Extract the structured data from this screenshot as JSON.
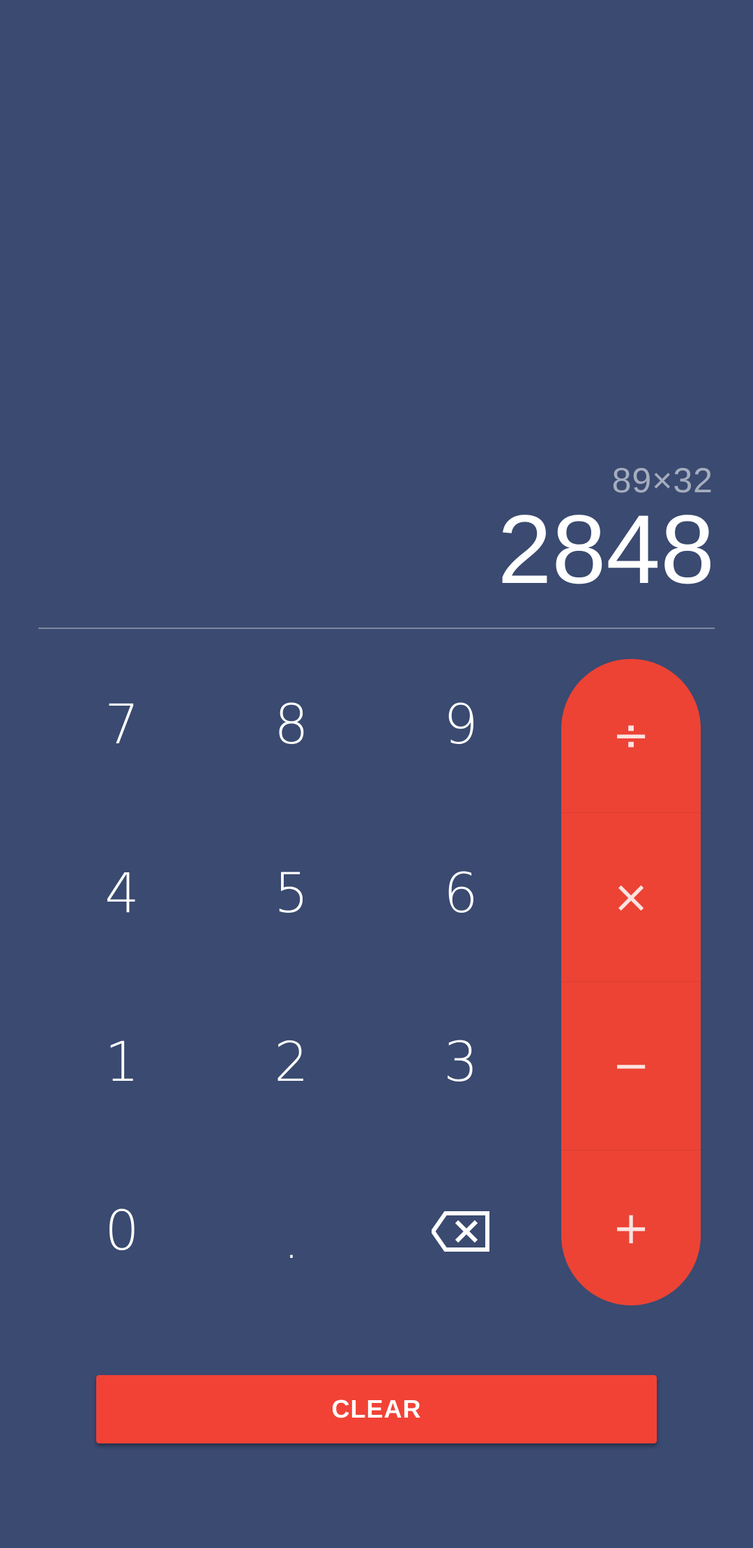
{
  "display": {
    "expression": "89×32",
    "result": "2848"
  },
  "keypad": {
    "digits": {
      "seven": "7",
      "eight": "8",
      "nine": "9",
      "four": "4",
      "five": "5",
      "six": "6",
      "one": "1",
      "two": "2",
      "three": "3",
      "zero": "0",
      "dot": "."
    },
    "backspace_icon": "backspace-icon"
  },
  "operators": {
    "divide": "÷",
    "multiply": "×",
    "minus": "−",
    "plus": "+"
  },
  "clear_label": "CLEAR",
  "colors": {
    "background": "#3a4a70",
    "operator_panel": "#ec4335",
    "clear_button": "#f24236",
    "text": "#ffffff"
  }
}
